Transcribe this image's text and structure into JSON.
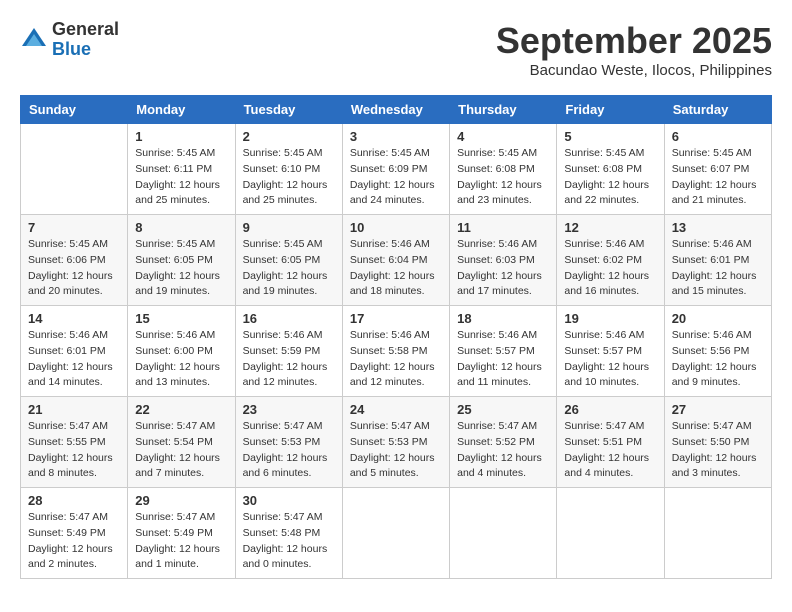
{
  "header": {
    "logo_general": "General",
    "logo_blue": "Blue",
    "month_title": "September 2025",
    "location": "Bacundao Weste, Ilocos, Philippines"
  },
  "weekdays": [
    "Sunday",
    "Monday",
    "Tuesday",
    "Wednesday",
    "Thursday",
    "Friday",
    "Saturday"
  ],
  "weeks": [
    [
      {
        "day": "",
        "sunrise": "",
        "sunset": "",
        "daylight": ""
      },
      {
        "day": "1",
        "sunrise": "Sunrise: 5:45 AM",
        "sunset": "Sunset: 6:11 PM",
        "daylight": "Daylight: 12 hours and 25 minutes."
      },
      {
        "day": "2",
        "sunrise": "Sunrise: 5:45 AM",
        "sunset": "Sunset: 6:10 PM",
        "daylight": "Daylight: 12 hours and 25 minutes."
      },
      {
        "day": "3",
        "sunrise": "Sunrise: 5:45 AM",
        "sunset": "Sunset: 6:09 PM",
        "daylight": "Daylight: 12 hours and 24 minutes."
      },
      {
        "day": "4",
        "sunrise": "Sunrise: 5:45 AM",
        "sunset": "Sunset: 6:08 PM",
        "daylight": "Daylight: 12 hours and 23 minutes."
      },
      {
        "day": "5",
        "sunrise": "Sunrise: 5:45 AM",
        "sunset": "Sunset: 6:08 PM",
        "daylight": "Daylight: 12 hours and 22 minutes."
      },
      {
        "day": "6",
        "sunrise": "Sunrise: 5:45 AM",
        "sunset": "Sunset: 6:07 PM",
        "daylight": "Daylight: 12 hours and 21 minutes."
      }
    ],
    [
      {
        "day": "7",
        "sunrise": "Sunrise: 5:45 AM",
        "sunset": "Sunset: 6:06 PM",
        "daylight": "Daylight: 12 hours and 20 minutes."
      },
      {
        "day": "8",
        "sunrise": "Sunrise: 5:45 AM",
        "sunset": "Sunset: 6:05 PM",
        "daylight": "Daylight: 12 hours and 19 minutes."
      },
      {
        "day": "9",
        "sunrise": "Sunrise: 5:45 AM",
        "sunset": "Sunset: 6:05 PM",
        "daylight": "Daylight: 12 hours and 19 minutes."
      },
      {
        "day": "10",
        "sunrise": "Sunrise: 5:46 AM",
        "sunset": "Sunset: 6:04 PM",
        "daylight": "Daylight: 12 hours and 18 minutes."
      },
      {
        "day": "11",
        "sunrise": "Sunrise: 5:46 AM",
        "sunset": "Sunset: 6:03 PM",
        "daylight": "Daylight: 12 hours and 17 minutes."
      },
      {
        "day": "12",
        "sunrise": "Sunrise: 5:46 AM",
        "sunset": "Sunset: 6:02 PM",
        "daylight": "Daylight: 12 hours and 16 minutes."
      },
      {
        "day": "13",
        "sunrise": "Sunrise: 5:46 AM",
        "sunset": "Sunset: 6:01 PM",
        "daylight": "Daylight: 12 hours and 15 minutes."
      }
    ],
    [
      {
        "day": "14",
        "sunrise": "Sunrise: 5:46 AM",
        "sunset": "Sunset: 6:01 PM",
        "daylight": "Daylight: 12 hours and 14 minutes."
      },
      {
        "day": "15",
        "sunrise": "Sunrise: 5:46 AM",
        "sunset": "Sunset: 6:00 PM",
        "daylight": "Daylight: 12 hours and 13 minutes."
      },
      {
        "day": "16",
        "sunrise": "Sunrise: 5:46 AM",
        "sunset": "Sunset: 5:59 PM",
        "daylight": "Daylight: 12 hours and 12 minutes."
      },
      {
        "day": "17",
        "sunrise": "Sunrise: 5:46 AM",
        "sunset": "Sunset: 5:58 PM",
        "daylight": "Daylight: 12 hours and 12 minutes."
      },
      {
        "day": "18",
        "sunrise": "Sunrise: 5:46 AM",
        "sunset": "Sunset: 5:57 PM",
        "daylight": "Daylight: 12 hours and 11 minutes."
      },
      {
        "day": "19",
        "sunrise": "Sunrise: 5:46 AM",
        "sunset": "Sunset: 5:57 PM",
        "daylight": "Daylight: 12 hours and 10 minutes."
      },
      {
        "day": "20",
        "sunrise": "Sunrise: 5:46 AM",
        "sunset": "Sunset: 5:56 PM",
        "daylight": "Daylight: 12 hours and 9 minutes."
      }
    ],
    [
      {
        "day": "21",
        "sunrise": "Sunrise: 5:47 AM",
        "sunset": "Sunset: 5:55 PM",
        "daylight": "Daylight: 12 hours and 8 minutes."
      },
      {
        "day": "22",
        "sunrise": "Sunrise: 5:47 AM",
        "sunset": "Sunset: 5:54 PM",
        "daylight": "Daylight: 12 hours and 7 minutes."
      },
      {
        "day": "23",
        "sunrise": "Sunrise: 5:47 AM",
        "sunset": "Sunset: 5:53 PM",
        "daylight": "Daylight: 12 hours and 6 minutes."
      },
      {
        "day": "24",
        "sunrise": "Sunrise: 5:47 AM",
        "sunset": "Sunset: 5:53 PM",
        "daylight": "Daylight: 12 hours and 5 minutes."
      },
      {
        "day": "25",
        "sunrise": "Sunrise: 5:47 AM",
        "sunset": "Sunset: 5:52 PM",
        "daylight": "Daylight: 12 hours and 4 minutes."
      },
      {
        "day": "26",
        "sunrise": "Sunrise: 5:47 AM",
        "sunset": "Sunset: 5:51 PM",
        "daylight": "Daylight: 12 hours and 4 minutes."
      },
      {
        "day": "27",
        "sunrise": "Sunrise: 5:47 AM",
        "sunset": "Sunset: 5:50 PM",
        "daylight": "Daylight: 12 hours and 3 minutes."
      }
    ],
    [
      {
        "day": "28",
        "sunrise": "Sunrise: 5:47 AM",
        "sunset": "Sunset: 5:49 PM",
        "daylight": "Daylight: 12 hours and 2 minutes."
      },
      {
        "day": "29",
        "sunrise": "Sunrise: 5:47 AM",
        "sunset": "Sunset: 5:49 PM",
        "daylight": "Daylight: 12 hours and 1 minute."
      },
      {
        "day": "30",
        "sunrise": "Sunrise: 5:47 AM",
        "sunset": "Sunset: 5:48 PM",
        "daylight": "Daylight: 12 hours and 0 minutes."
      },
      {
        "day": "",
        "sunrise": "",
        "sunset": "",
        "daylight": ""
      },
      {
        "day": "",
        "sunrise": "",
        "sunset": "",
        "daylight": ""
      },
      {
        "day": "",
        "sunrise": "",
        "sunset": "",
        "daylight": ""
      },
      {
        "day": "",
        "sunrise": "",
        "sunset": "",
        "daylight": ""
      }
    ]
  ]
}
